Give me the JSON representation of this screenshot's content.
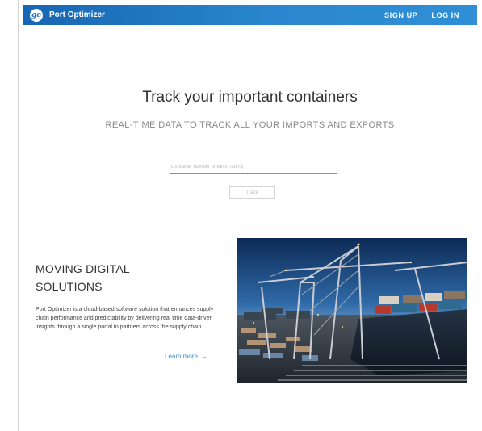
{
  "header": {
    "app_name": "Port Optimizer",
    "logo_glyph": "ge",
    "logo_icon": "ge-logo-icon",
    "sign_up": "SIGN UP",
    "log_in": "LOG IN",
    "gradient_start": "#1766b3",
    "gradient_end": "#2f8fd6"
  },
  "hero": {
    "title": "Track your important containers",
    "subtitle": "REAL-TIME DATA TO TRACK ALL YOUR IMPORTS AND EXPORTS"
  },
  "tracking": {
    "placeholder": "Container number or Bill of lading",
    "button_label": "Track"
  },
  "promo": {
    "heading_line1": "MOVING DIGITAL",
    "heading_line2": "SOLUTIONS",
    "body": "Port Optimizer is a cloud-based software solution that enhances supply chain performance and predictability by delivering real time data-driven insights through a single portal to partners across the supply chain.",
    "learn_more": "Learn more",
    "learn_more_arrow": "→",
    "link_color": "#3a8fd8"
  }
}
